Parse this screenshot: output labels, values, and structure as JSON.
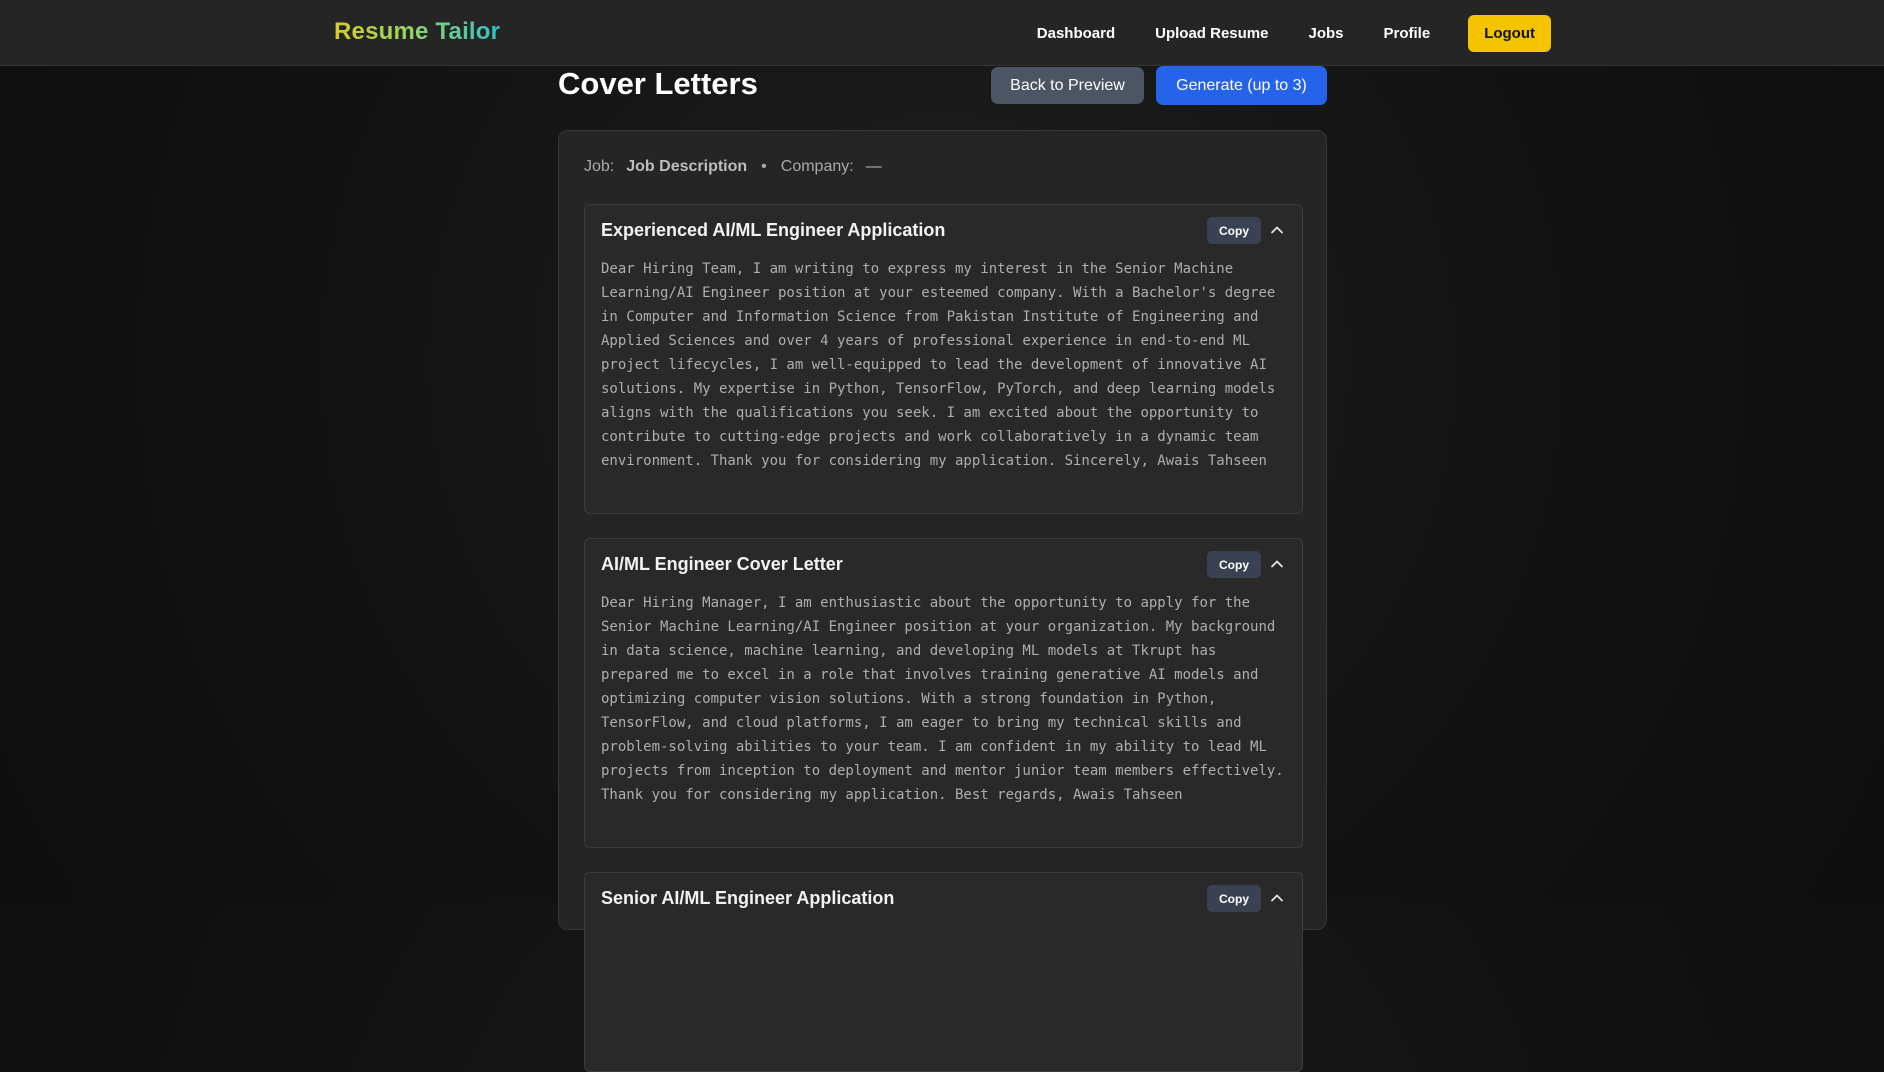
{
  "app": {
    "logo": "Resume Tailor"
  },
  "nav": {
    "items": [
      {
        "label": "Dashboard"
      },
      {
        "label": "Upload Resume"
      },
      {
        "label": "Jobs"
      },
      {
        "label": "Profile"
      }
    ],
    "logout_label": "Logout"
  },
  "page": {
    "title": "Cover Letters",
    "back_label": "Back to Preview",
    "generate_label": "Generate (up to 3)"
  },
  "meta": {
    "job_label": "Job:",
    "job_value": "Job Description",
    "separator": "•",
    "company_label": "Company:",
    "company_value": "—"
  },
  "letters": [
    {
      "title": "Experienced AI/ML Engineer Application",
      "copy_label": "Copy",
      "body": "Dear Hiring Team, I am writing to express my interest in the Senior Machine Learning/AI Engineer position at your esteemed company. With a Bachelor's degree in Computer and Information Science from Pakistan Institute of Engineering and Applied Sciences and over 4 years of professional experience in end-to-end ML project lifecycles, I am well-equipped to lead the development of innovative AI solutions. My expertise in Python, TensorFlow, PyTorch, and deep learning models aligns with the qualifications you seek. I am excited about the opportunity to contribute to cutting-edge projects and work collaboratively in a dynamic team environment. Thank you for considering my application. Sincerely, Awais Tahseen"
    },
    {
      "title": "AI/ML Engineer Cover Letter",
      "copy_label": "Copy",
      "body": "Dear Hiring Manager, I am enthusiastic about the opportunity to apply for the Senior Machine Learning/AI Engineer position at your organization. My background in data science, machine learning, and developing ML models at Tkrupt has prepared me to excel in a role that involves training generative AI models and optimizing computer vision solutions. With a strong foundation in Python, TensorFlow, and cloud platforms, I am eager to bring my technical skills and problem-solving abilities to your team. I am confident in my ability to lead ML projects from inception to deployment and mentor junior team members effectively. Thank you for considering my application. Best regards, Awais Tahseen"
    },
    {
      "title": "Senior AI/ML Engineer Application",
      "copy_label": "Copy",
      "body": ""
    }
  ],
  "colors": {
    "logout_bg": "#f5c400",
    "generate_bg": "#2563eb",
    "back_bg": "#4b5563",
    "copy_bg": "#3a4252"
  },
  "icons": {
    "collapse": "chevron-up-icon"
  }
}
